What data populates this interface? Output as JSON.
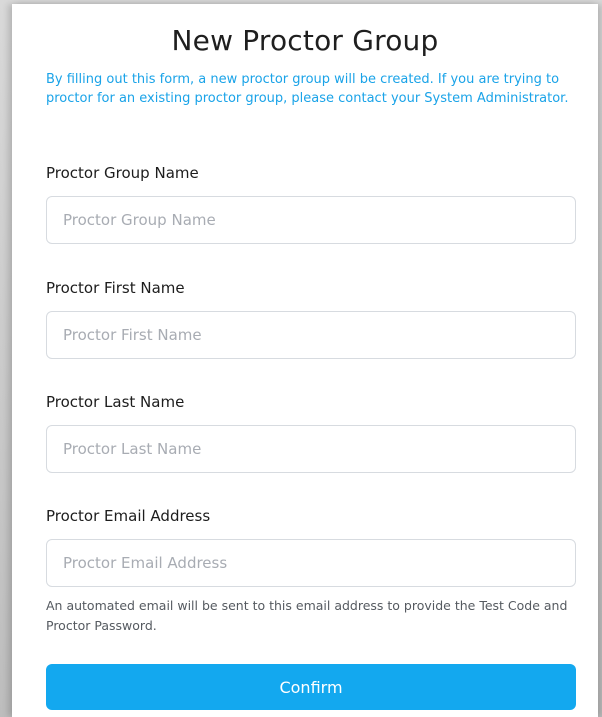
{
  "form": {
    "title": "New Proctor Group",
    "intro": "By filling out this form, a new proctor group will be created. If you are trying to proctor for an existing proctor group, please contact your System Administrator.",
    "fields": [
      {
        "label": "Proctor Group Name",
        "placeholder": "Proctor Group Name",
        "value": ""
      },
      {
        "label": "Proctor First Name",
        "placeholder": "Proctor First Name",
        "value": ""
      },
      {
        "label": "Proctor Last Name",
        "placeholder": "Proctor Last Name",
        "value": ""
      },
      {
        "label": "Proctor Email Address",
        "placeholder": "Proctor Email Address",
        "value": ""
      }
    ],
    "email_helper": "An automated email will be sent to this email address to provide the Test Code and Proctor Password.",
    "confirm_label": "Confirm"
  },
  "colors": {
    "accent": "#13a8ef",
    "intro_text": "#1aa3e8"
  }
}
